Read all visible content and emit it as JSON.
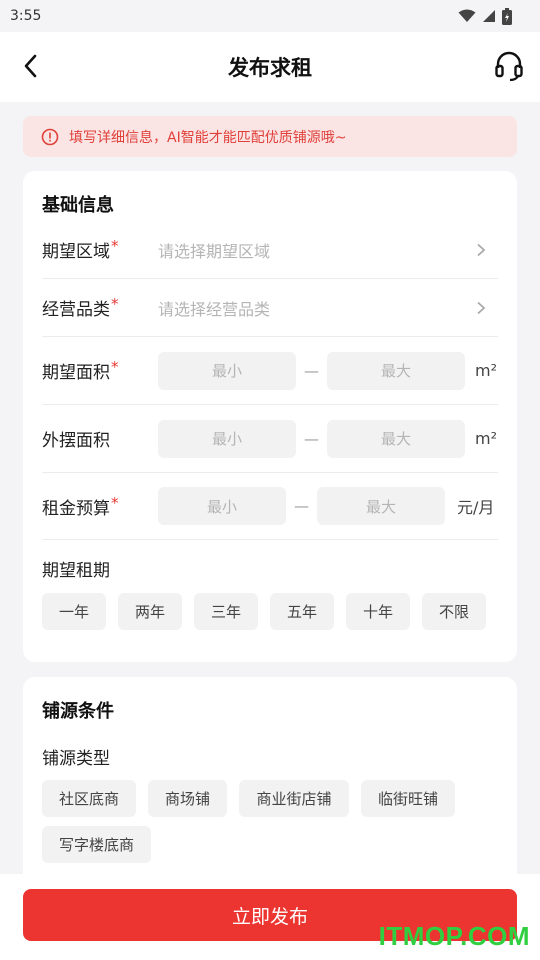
{
  "status_bar": {
    "time": "3:55"
  },
  "nav": {
    "title": "发布求租"
  },
  "notice": {
    "text": "填写详细信息，AI智能才能匹配优质铺源哦~"
  },
  "basic": {
    "heading": "基础信息",
    "area_label": "期望区域",
    "area_placeholder": "请选择期望区域",
    "category_label": "经营品类",
    "category_placeholder": "请选择经营品类",
    "size_label": "期望面积",
    "size_min": "最小",
    "size_max": "最大",
    "size_unit": "m²",
    "outdoor_label": "外摆面积",
    "outdoor_min": "最小",
    "outdoor_max": "最大",
    "outdoor_unit": "m²",
    "budget_label": "租金预算",
    "budget_min": "最小",
    "budget_max": "最大",
    "budget_unit": "元/月",
    "dash": "—",
    "required_mark": "*",
    "term_label": "期望租期",
    "term_options": [
      "一年",
      "两年",
      "三年",
      "五年",
      "十年",
      "不限"
    ]
  },
  "shop": {
    "heading": "铺源条件",
    "type_label": "铺源类型",
    "type_options": [
      "社区底商",
      "商场铺",
      "商业街店铺",
      "临街旺铺",
      "写字楼底商"
    ]
  },
  "footer": {
    "submit_label": "立即发布"
  },
  "watermark": {
    "text": "ITMOP.COM"
  },
  "colors": {
    "accent": "#ec3530",
    "notice_bg": "#fbe4e4",
    "watermark": "#2fcf41"
  },
  "icons": [
    "back-arrow-icon",
    "headset-icon",
    "info-icon",
    "chevron-right-icon",
    "wifi-icon",
    "signal-icon",
    "battery-icon"
  ]
}
